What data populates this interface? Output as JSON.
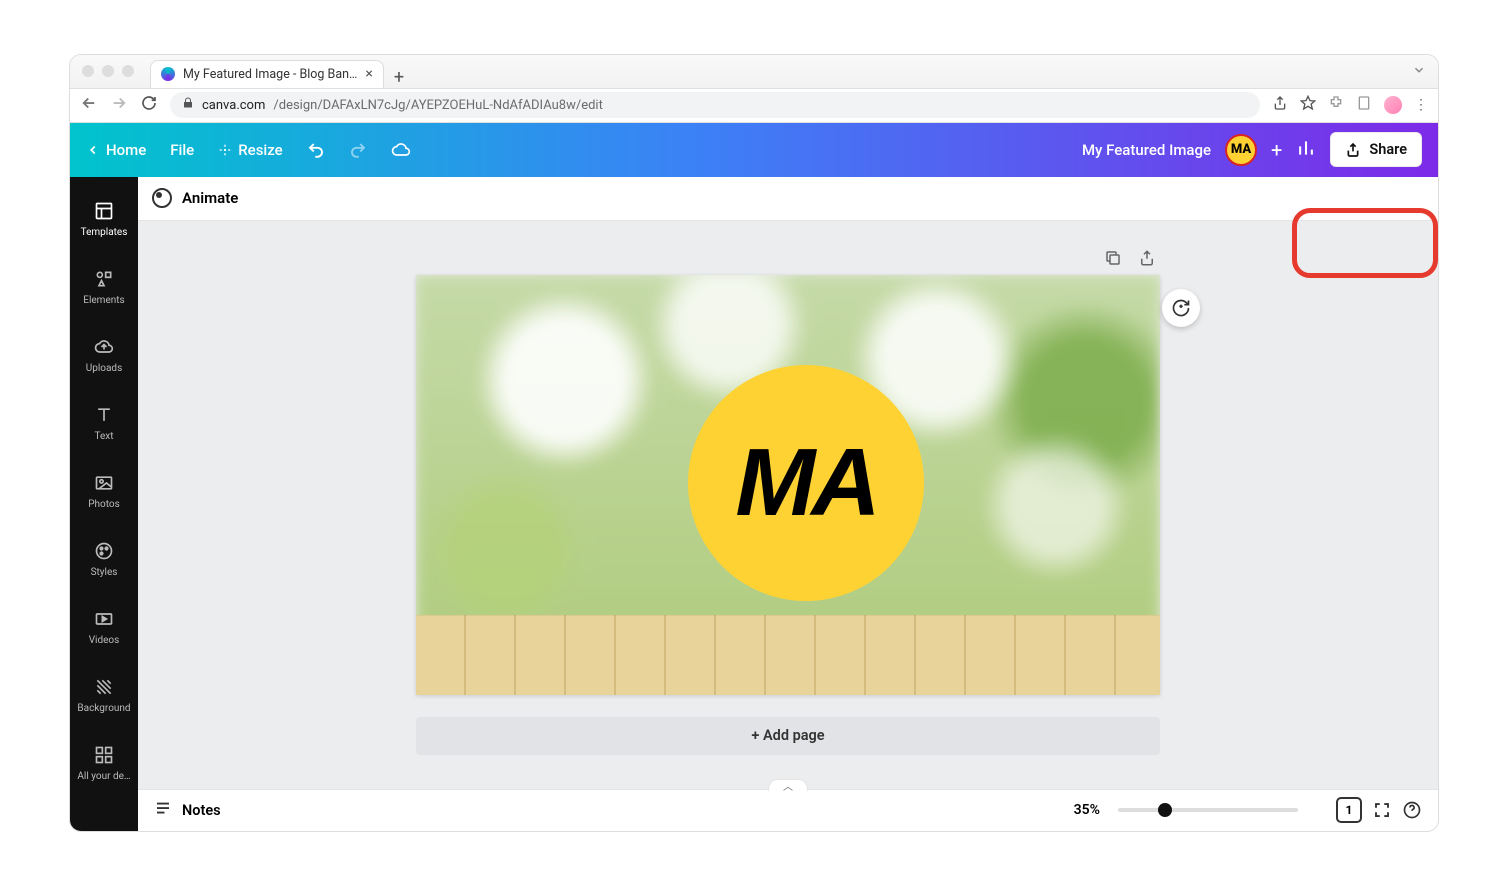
{
  "browser": {
    "tab_title": "My Featured Image - Blog Ban…",
    "url_host": "canva.com",
    "url_path": "/design/DAFAxLN7cJg/AYEPZOEHuL-NdAfADIAu8w/edit"
  },
  "topbar": {
    "home": "Home",
    "file": "File",
    "resize": "Resize",
    "design_title": "My Featured Image",
    "avatar_initials": "MA",
    "share": "Share"
  },
  "context": {
    "animate": "Animate"
  },
  "sidebar": {
    "items": [
      {
        "label": "Templates"
      },
      {
        "label": "Elements"
      },
      {
        "label": "Uploads"
      },
      {
        "label": "Text"
      },
      {
        "label": "Photos"
      },
      {
        "label": "Styles"
      },
      {
        "label": "Videos"
      },
      {
        "label": "Background"
      },
      {
        "label": "All your de…"
      }
    ]
  },
  "canvas": {
    "logo_text": "MA",
    "add_page": "+ Add page"
  },
  "bottombar": {
    "notes": "Notes",
    "zoom": "35%",
    "page_num": "1"
  }
}
